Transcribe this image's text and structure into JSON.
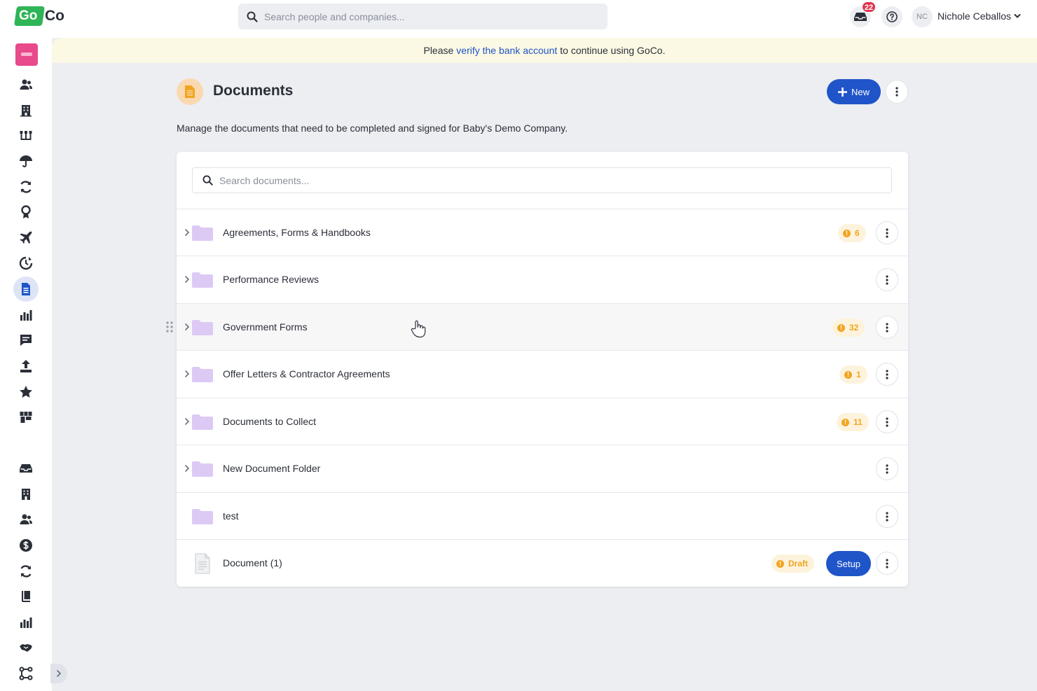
{
  "app": {
    "logo_go": "Go",
    "logo_co": "Co"
  },
  "header": {
    "search_placeholder": "Search people and companies...",
    "notification_count": "22",
    "avatar_initials": "NC",
    "user_name": "Nichole Ceballos"
  },
  "banner": {
    "prefix": "Please",
    "link": "verify the bank account",
    "suffix": "to continue using GoCo."
  },
  "page": {
    "title": "Documents",
    "new_label": "New",
    "description": "Manage the documents that need to be completed and signed for Baby's Demo Company."
  },
  "documents": {
    "search_placeholder": "Search documents...",
    "rows": [
      {
        "label": "Agreements, Forms & Handbooks",
        "type": "folder",
        "expandable": true,
        "badge": "6"
      },
      {
        "label": "Performance Reviews",
        "type": "folder",
        "expandable": true,
        "badge": ""
      },
      {
        "label": "Government Forms",
        "type": "folder",
        "expandable": true,
        "badge": "32"
      },
      {
        "label": "Offer Letters & Contractor Agreements",
        "type": "folder",
        "expandable": true,
        "badge": "1"
      },
      {
        "label": "Documents to Collect",
        "type": "folder",
        "expandable": true,
        "badge": "11"
      },
      {
        "label": "New Document Folder",
        "type": "folder",
        "expandable": true,
        "badge": ""
      },
      {
        "label": "test",
        "type": "folder",
        "expandable": false,
        "badge": ""
      },
      {
        "label": "Document (1)",
        "type": "file",
        "expandable": false,
        "badge": "Draft",
        "action": "Setup"
      }
    ]
  },
  "sidebar_icons": [
    "people-icon",
    "building-icon",
    "org-chart-icon",
    "umbrella-icon",
    "sync-icon",
    "award-icon",
    "plane-icon",
    "timer-icon",
    "document-icon",
    "bar-chart-icon",
    "chat-icon",
    "upload-icon",
    "star-icon",
    "store-icon",
    "inbox-icon",
    "company-icon",
    "team-icon",
    "dollar-icon",
    "refresh-icon",
    "book-icon",
    "reports-icon",
    "handshake-icon",
    "workflow-icon"
  ],
  "colors": {
    "primary": "#1f55c8",
    "warning": "#f1a521",
    "folder": "#dccaf5",
    "banner": "#fbf8e3",
    "logo_green": "#2fb457"
  }
}
